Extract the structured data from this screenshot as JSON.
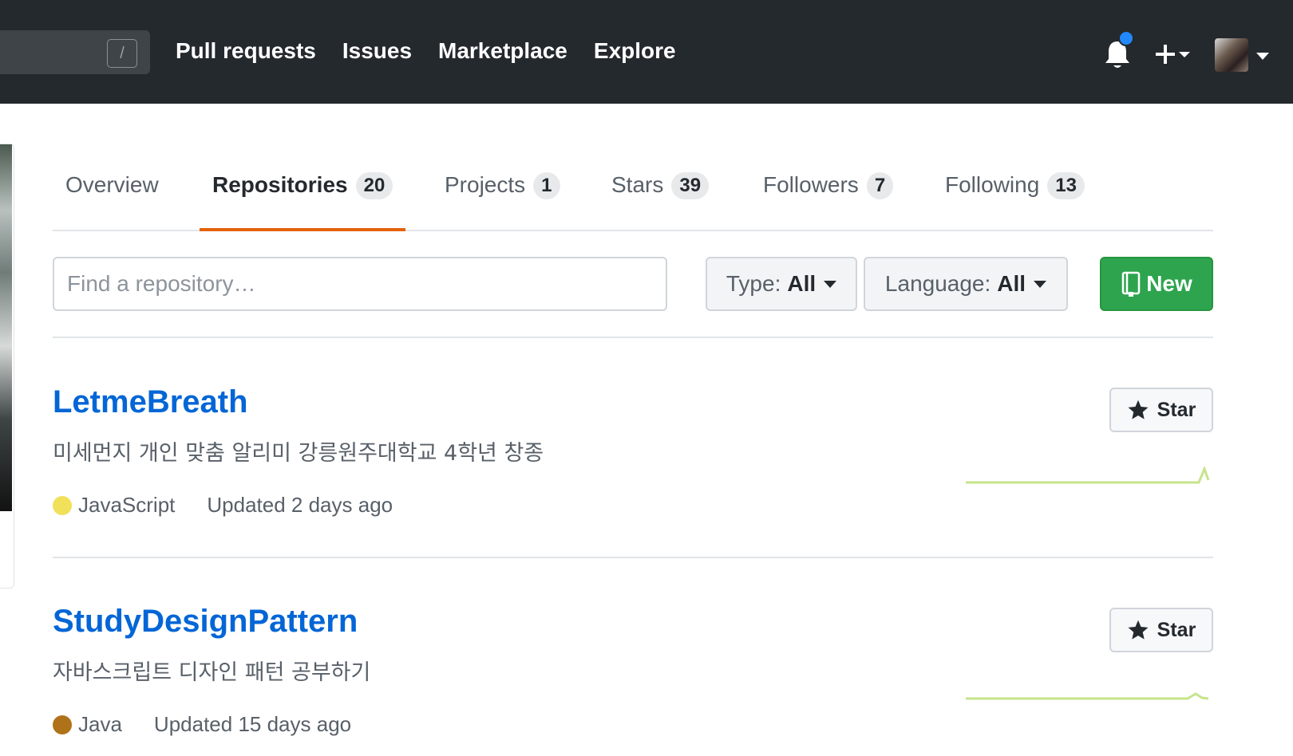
{
  "header": {
    "search_key": "/",
    "nav": [
      "Pull requests",
      "Issues",
      "Marketplace",
      "Explore"
    ],
    "icons": [
      "bell-icon",
      "plus-icon",
      "avatar"
    ],
    "notification_color": "#2188ff"
  },
  "tabs": [
    {
      "label": "Overview",
      "count": null
    },
    {
      "label": "Repositories",
      "count": "20",
      "selected": true
    },
    {
      "label": "Projects",
      "count": "1"
    },
    {
      "label": "Stars",
      "count": "39"
    },
    {
      "label": "Followers",
      "count": "7"
    },
    {
      "label": "Following",
      "count": "13"
    }
  ],
  "filters": {
    "search_placeholder": "Find a repository…",
    "type_key": "Type:",
    "type_value": "All",
    "language_key": "Language:",
    "language_value": "All",
    "new_label": "New"
  },
  "repos": [
    {
      "name": "LetmeBreath",
      "description": "미세먼지 개인 맞춤 알리미 강릉원주대학교 4학년 창종",
      "language": "JavaScript",
      "language_color": "#f1e05a",
      "updated": "Updated 2 days ago",
      "star_label": "Star"
    },
    {
      "name": "StudyDesignPattern",
      "description": "자바스크립트 디자인 패턴 공부하기",
      "language": "Java",
      "language_color": "#b07219",
      "updated": "Updated 15 days ago",
      "star_label": "Star"
    }
  ],
  "colors": {
    "header_bg": "#24292e",
    "link": "#0366d6",
    "tab_underline": "#e36209",
    "new_button": "#2ea44f",
    "sparkline": "#c6e48b"
  }
}
